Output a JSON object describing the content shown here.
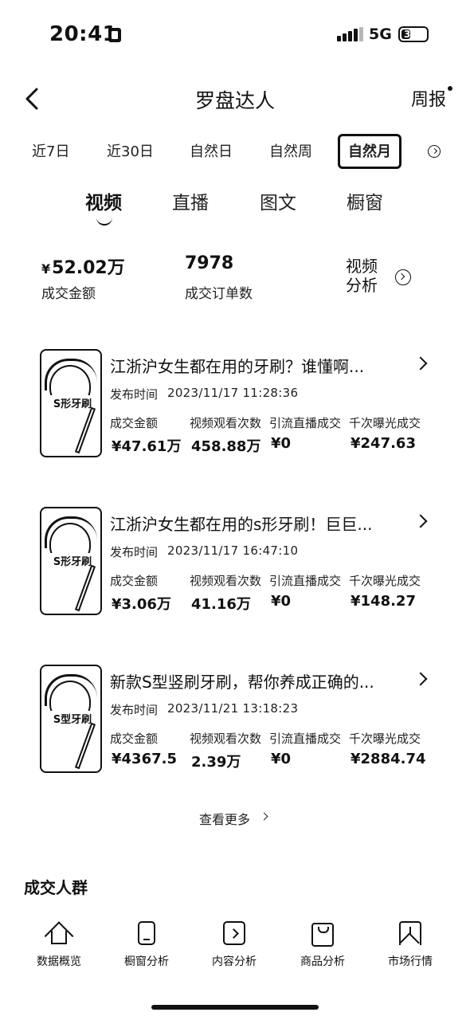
{
  "status_bar": {
    "time": "20:41",
    "network": "5G",
    "battery": "37",
    "battery_level": 0.37
  },
  "nav": {
    "title": "罗盘达人",
    "weekly_report": "周报"
  },
  "period_tabs": [
    "近7日",
    "近30日",
    "自然日",
    "自然周",
    "自然月"
  ],
  "active_period": "自然月",
  "content_tabs": [
    "视频",
    "直播",
    "图文",
    "橱窗"
  ],
  "active_content_tab": "视频",
  "summary": {
    "gmv_currency": "¥",
    "gmv": "52.02万",
    "gmv_label": "成交金额",
    "orders": "7978",
    "orders_label": "成交订单数",
    "video_analysis": "视频分析"
  },
  "metric_labels": [
    "成交金额",
    "视频观看次数",
    "引流直播成交",
    "千次曝光成交"
  ],
  "publish_label": "发布时间",
  "videos": [
    {
      "title": "江浙沪女生都在用的牙刷？谁懂啊...",
      "publish_time": "2023/11/17 11:28:36",
      "thumb_caption": "S形牙刷",
      "metrics": [
        "¥47.61万",
        "458.88万",
        "¥0",
        "¥247.63"
      ]
    },
    {
      "title": "江浙沪女生都在用的s形牙刷！巨巨...",
      "publish_time": "2023/11/17 16:47:10",
      "thumb_caption": "S形牙刷",
      "metrics": [
        "¥3.06万",
        "41.16万",
        "¥0",
        "¥148.27"
      ]
    },
    {
      "title": "新款S型竖刷牙刷，帮你养成正确的...",
      "publish_time": "2023/11/21 13:18:23",
      "thumb_caption": "S型牙刷",
      "metrics": [
        "¥4367.5",
        "2.39万",
        "¥0",
        "¥2884.74"
      ]
    }
  ],
  "see_more": "查看更多",
  "section_title": "成交人群",
  "bottom_nav": [
    "数据概览",
    "橱窗分析",
    "内容分析",
    "商品分析",
    "市场行情"
  ],
  "icons": {
    "back": "back-icon",
    "info": "info-icon",
    "video_analysis": "circle-chevron-icon",
    "bottom_nav": [
      "home-icon",
      "phone-icon",
      "play-icon",
      "bag-icon",
      "bookmark-icon"
    ]
  }
}
